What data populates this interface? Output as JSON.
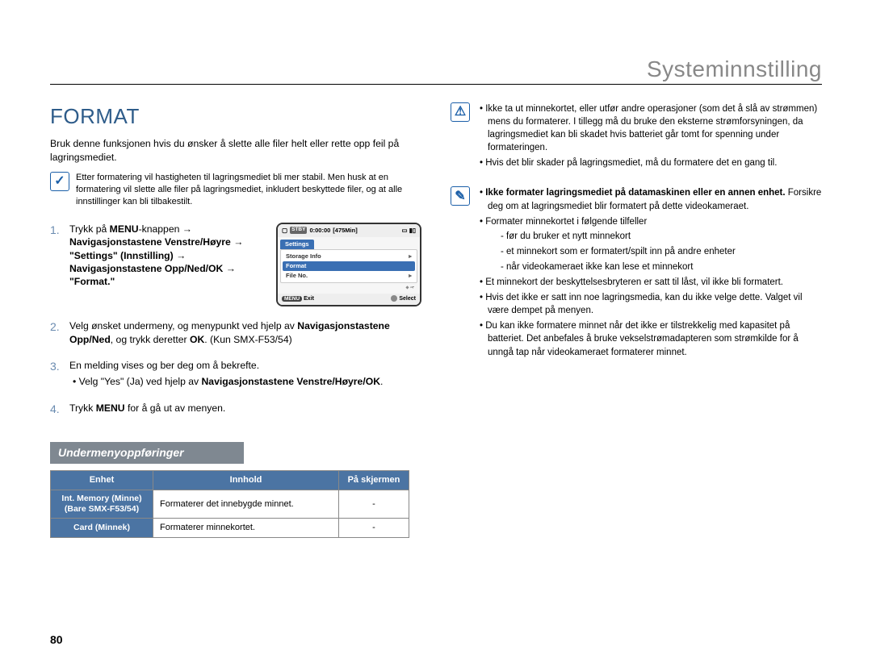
{
  "header": "Systeminnstilling",
  "page_number": "80",
  "section_title": "FORMAT",
  "intro": "Bruk denne funksjonen hvis du ønsker å slette alle filer helt eller rette opp feil på lagringsmediet.",
  "note_left": "Etter formatering vil hastigheten til lagringsmediet bli mer stabil. Men husk at en formatering vil slette alle filer på lagringsmediet, inkludert beskyttede filer, og at alle innstillinger kan bli tilbakestilt.",
  "steps": {
    "s1_prefix": "Trykk på ",
    "s1_menu": "MENU",
    "s1_after_menu": "-knappen → ",
    "s1_nav1": "Navigasjonstastene Venstre/Høyre",
    "s1_arrow1": " → ",
    "s1_settings": "\"Settings\" (Innstilling)",
    "s1_arrow2": " → ",
    "s1_nav2": "Navigasjonstastene Opp/Ned/OK",
    "s1_arrow3": " → ",
    "s1_format": "\"Format.\"",
    "s2_line1": "Velg ønsket undermeny, og menypunkt ved hjelp av ",
    "s2_nav": "Navigasjonstastene Opp/Ned",
    "s2_after": ", og trykk deretter ",
    "s2_ok": "OK",
    "s2_model": ". (Kun SMX-F53/54)",
    "s3_main": "En melding vises og ber deg om å bekrefte.",
    "s3_sub_before": "Velg \"Yes\" (Ja) ved hjelp av ",
    "s3_sub_bold": "Navigasjonstastene Venstre/Høyre/OK",
    "s3_sub_after": ".",
    "s4_before": "Trykk ",
    "s4_menu": "MENU",
    "s4_after": " for å gå ut av menyen."
  },
  "screen": {
    "stby_label": "STBY",
    "time": "0:00:00",
    "remain": "[475Min]",
    "tab": "Settings",
    "item1": "Storage Info",
    "item2": "Format",
    "item3": "File No.",
    "exit_label": "Exit",
    "exit_pill": "MENU",
    "select_label": "Select"
  },
  "subheading": "Undermenyoppføringer",
  "table": {
    "th_unit": "Enhet",
    "th_content": "Innhold",
    "th_screen": "På skjermen",
    "row1_unit": "Int. Memory (Minne) (Bare SMX-F53/54)",
    "row1_content": "Formaterer det innebygde minnet.",
    "row1_screen": "-",
    "row2_unit": "Card (Minnek)",
    "row2_content": "Formaterer minnekortet.",
    "row2_screen": "-"
  },
  "warn_list": {
    "i1": "Ikke ta ut minnekortet, eller utfør andre operasjoner (som det å slå av strømmen) mens du formaterer. I tillegg må du bruke den eksterne strømforsyningen, da lagringsmediet kan bli skadet hvis batteriet går tomt for spenning under formateringen.",
    "i2": "Hvis det blir skader på lagringsmediet, må du formatere det en gang til."
  },
  "info_list": {
    "b1_bold": "Ikke formater lagringsmediet på datamaskinen eller en annen enhet.",
    "b1_rest": " Forsikre deg om at lagringsmediet blir formatert på dette videokameraet.",
    "b2_head": "Formater minnekortet i følgende tilfeller",
    "b2_a": "før du bruker et nytt minnekort",
    "b2_b": "et minnekort som er formatert/spilt inn på andre enheter",
    "b2_c": "når videokameraet ikke kan lese et minnekort",
    "b3": "Et minnekort der beskyttelsesbryteren er satt til låst, vil ikke bli formatert.",
    "b4": "Hvis det ikke er satt inn noe lagringsmedia, kan du ikke velge dette. Valget vil være dempet på menyen.",
    "b5": "Du kan ikke formatere minnet når det ikke er tilstrekkelig med kapasitet på batteriet. Det anbefales å bruke vekselstrømadapteren som strømkilde for å unngå tap når videokameraet formaterer minnet."
  }
}
